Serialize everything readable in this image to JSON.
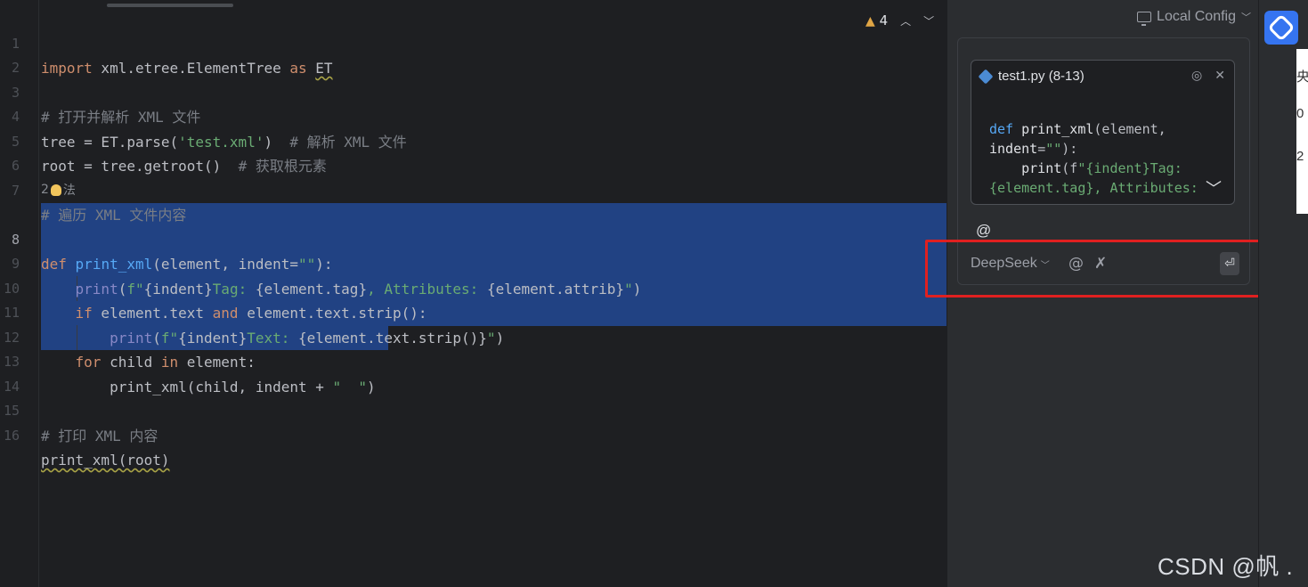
{
  "editor": {
    "inspection_count": "4",
    "hint_text": "2 用法",
    "lines": [
      {
        "num": "1",
        "text": "import xml.etree.ElementTree as ET"
      },
      {
        "num": "2",
        "text": ""
      },
      {
        "num": "3",
        "text": "# 打开并解析 XML 文件"
      },
      {
        "num": "4",
        "text": "tree = ET.parse('test.xml')  # 解析 XML 文件"
      },
      {
        "num": "5",
        "text": "root = tree.getroot()  # 获取根元素"
      },
      {
        "num": "6",
        "text": ""
      },
      {
        "num": "7",
        "text": "# 遍历 XML 文件内容"
      },
      {
        "num": "8",
        "text": "def print_xml(element, indent=\"\"):"
      },
      {
        "num": "9",
        "text": "    print(f\"{indent}Tag: {element.tag}, Attributes: {element.attrib}\")"
      },
      {
        "num": "10",
        "text": "    if element.text and element.text.strip():"
      },
      {
        "num": "11",
        "text": "        print(f\"{indent}Text: {element.text.strip()}\")"
      },
      {
        "num": "12",
        "text": "    for child in element:"
      },
      {
        "num": "13",
        "text": "        print_xml(child, indent + \"  \")"
      },
      {
        "num": "14",
        "text": ""
      },
      {
        "num": "15",
        "text": "# 打印 XML 内容"
      },
      {
        "num": "16",
        "text": "print_xml(root)"
      }
    ]
  },
  "panel": {
    "config_label": "Local Config",
    "context_card": {
      "title": "test1.py (8-13)",
      "code_lines": [
        "def print_xml(element,",
        "indent=\"\"):",
        "    print(f\"{indent}Tag:",
        "{element.tag}, Attributes:"
      ]
    },
    "at_symbol": "@",
    "model_label": "DeepSeek",
    "mention_symbol": "@"
  },
  "rightbar": {
    "peek_chars": [
      "央",
      "0",
      "2"
    ]
  },
  "watermark": "CSDN @帆 .",
  "colors": {
    "selection": "#214283",
    "keyword": "#cf8e6d",
    "function": "#56a8f5",
    "string": "#6aab73",
    "comment": "#7a7e85",
    "highlight_box": "#e02020",
    "ai_brand": "#3574f0"
  },
  "icons": [
    "warning-icon",
    "chevron-up-icon",
    "chevron-down-icon",
    "lightbulb-icon",
    "monitor-icon",
    "python-file-icon",
    "eye-off-icon",
    "close-icon",
    "expand-icon",
    "at-icon",
    "tools-icon",
    "send-icon",
    "ai-assistant-icon"
  ]
}
